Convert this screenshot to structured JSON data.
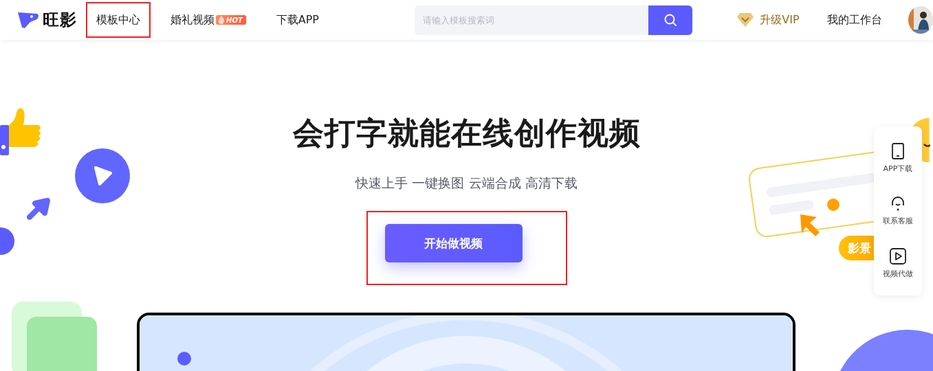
{
  "header": {
    "logo": "旺影",
    "nav": [
      {
        "label": "模板中心",
        "highlighted": true
      },
      {
        "label": "婚礼视频",
        "badge": "HOT",
        "highlighted": false
      },
      {
        "label": "下载APP",
        "highlighted": false
      }
    ],
    "search": {
      "placeholder": "请输入模板搜索词"
    },
    "vip": "升级VIP",
    "workspace": "我的工作台"
  },
  "hero": {
    "title": "会打字就能在线创作视频",
    "subtitle": "快速上手 一键换图 云端合成 高清下载",
    "cta": {
      "label": "开始做视频",
      "highlighted": true
    }
  },
  "decor_tag": "影景",
  "side_panel": [
    {
      "kind": "phone",
      "label": "APP下载"
    },
    {
      "kind": "headset",
      "label": "联系客服"
    },
    {
      "kind": "play",
      "label": "视频代做"
    }
  ]
}
